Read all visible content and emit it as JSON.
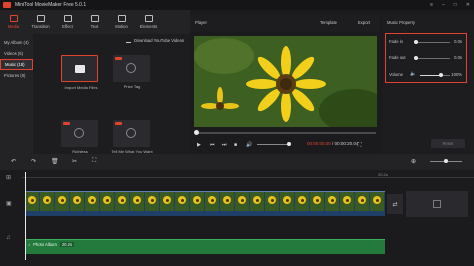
{
  "app": {
    "title": "MiniTool MovieMaker Free 5.0.1"
  },
  "media_tabs": [
    "Media",
    "Transition",
    "Effect",
    "Text",
    "Motion",
    "Elements"
  ],
  "sidebar": {
    "items": [
      "My Album (4)",
      "Videos (6)",
      "Music (18)",
      "Pictures (8)"
    ],
    "active": "Music (18)"
  },
  "library": {
    "download_link": "Download YouTube Videos",
    "cards": [
      "Import Media Files",
      "Price Tag",
      "Ruthless",
      "Tell Me What You Want"
    ]
  },
  "player": {
    "label": "Player",
    "template_btn": "Template",
    "export_btn": "Export",
    "time_current": "00:00:00.00",
    "time_total": "00:00:20.04"
  },
  "music_property": {
    "title": "Music Property",
    "rows": [
      {
        "label": "Fade in",
        "value": "0.0s",
        "level": 0.0
      },
      {
        "label": "Fade out",
        "value": "0.0s",
        "level": 0.0
      },
      {
        "label": "Volume",
        "value": "100%",
        "level": 0.7
      }
    ],
    "reset_btn": "Reset"
  },
  "timeline": {
    "ruler_tick": "20.2s",
    "audio_clip": {
      "name": "Photo Album",
      "duration": "20.2s"
    }
  },
  "colors": {
    "accent": "#e2432f",
    "video_track": "#1f3e68",
    "audio_track": "#237a3c"
  }
}
